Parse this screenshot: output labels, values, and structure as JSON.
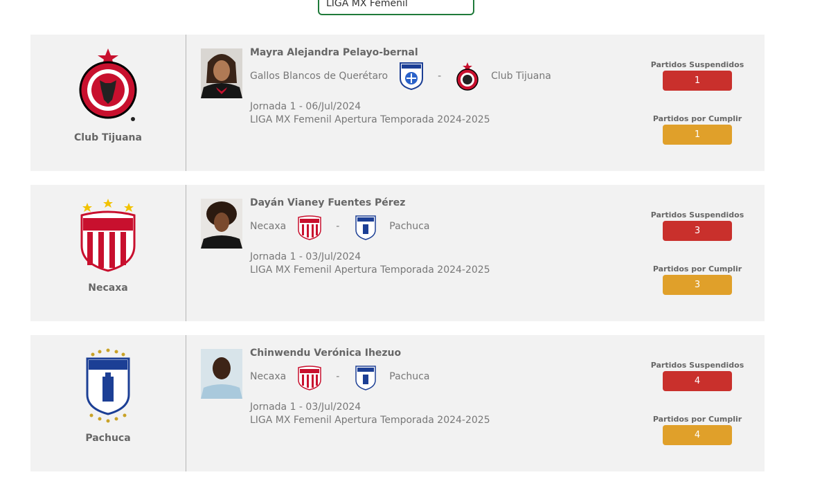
{
  "filter": {
    "league_value": "LIGA MX Femenil"
  },
  "colors": {
    "suspended": "#c9302c",
    "pending": "#e0a02a",
    "select_border": "#1f7a3a"
  },
  "labels": {
    "suspended": "Partidos Suspendidos",
    "pending": "Partidos por Cumplir",
    "dash": "-"
  },
  "cards": [
    {
      "team": "Club Tijuana",
      "player": "Mayra Alejandra Pelayo-bernal",
      "home": "Gallos Blancos de Querétaro",
      "away": "Club Tijuana",
      "jornada": "Jornada 1 - 06/Jul/2024",
      "competition": "LIGA MX Femenil Apertura Temporada 2024-2025",
      "suspended": "1",
      "pending": "1"
    },
    {
      "team": "Necaxa",
      "player": "Dayán Vianey Fuentes Pérez",
      "home": "Necaxa",
      "away": "Pachuca",
      "jornada": "Jornada 1 - 03/Jul/2024",
      "competition": "LIGA MX Femenil Apertura Temporada 2024-2025",
      "suspended": "3",
      "pending": "3"
    },
    {
      "team": "Pachuca",
      "player": "Chinwendu Verónica Ihezuo",
      "home": "Necaxa",
      "away": "Pachuca",
      "jornada": "Jornada 1 - 03/Jul/2024",
      "competition": "LIGA MX Femenil Apertura Temporada 2024-2025",
      "suspended": "4",
      "pending": "4"
    }
  ]
}
